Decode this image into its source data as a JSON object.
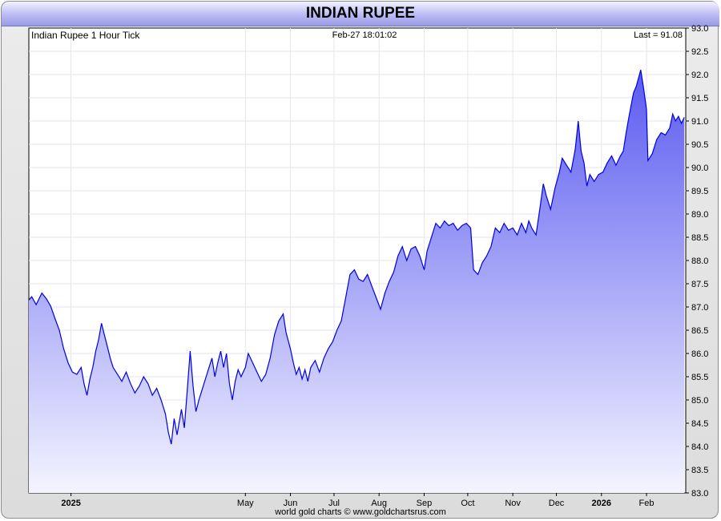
{
  "title": "INDIAN RUPEE",
  "footer": "world gold charts © www.goldchartsrus.com",
  "colors": {
    "line": "#0000e6",
    "fill_top": "#5b5bf0",
    "fill_bottom": "#f4f4ff",
    "grid": "#e6e6ee"
  },
  "chart_data": {
    "type": "area",
    "caption_left": "Indian Rupee 1 Hour Tick",
    "caption_center": "Feb-27  18:01:02",
    "caption_right": "Last = 91.08",
    "ylim": [
      83.0,
      93.0
    ],
    "xlim": [
      "2024-12-03",
      "2026-02-28"
    ],
    "grid": true,
    "y_ticks": [
      "93.0",
      "92.5",
      "92.0",
      "91.5",
      "91.0",
      "90.5",
      "90.0",
      "89.5",
      "89.0",
      "88.5",
      "88.0",
      "87.5",
      "87.0",
      "86.5",
      "86.0",
      "85.5",
      "85.0",
      "84.5",
      "84.0",
      "83.5",
      "83.0"
    ],
    "x_ticks": [
      {
        "label": "2025",
        "date": "2025-01-01",
        "bold": true
      },
      {
        "label": "May",
        "date": "2025-05-01",
        "bold": false
      },
      {
        "label": "Jun",
        "date": "2025-06-01",
        "bold": false
      },
      {
        "label": "Jul",
        "date": "2025-07-01",
        "bold": false
      },
      {
        "label": "Aug",
        "date": "2025-08-01",
        "bold": false
      },
      {
        "label": "Sep",
        "date": "2025-09-01",
        "bold": false
      },
      {
        "label": "Oct",
        "date": "2025-10-01",
        "bold": false
      },
      {
        "label": "Nov",
        "date": "2025-11-01",
        "bold": false
      },
      {
        "label": "Dec",
        "date": "2025-12-01",
        "bold": false
      },
      {
        "label": "2026",
        "date": "2026-01-01",
        "bold": true
      },
      {
        "label": "Feb",
        "date": "2026-02-01",
        "bold": false
      }
    ],
    "series": [
      {
        "points": [
          [
            "2024-12-03",
            87.15
          ],
          [
            "2024-12-05",
            87.22
          ],
          [
            "2024-12-08",
            87.05
          ],
          [
            "2024-12-12",
            87.3
          ],
          [
            "2024-12-15",
            87.18
          ],
          [
            "2024-12-18",
            87.02
          ],
          [
            "2024-12-21",
            86.75
          ],
          [
            "2024-12-24",
            86.5
          ],
          [
            "2024-12-27",
            86.1
          ],
          [
            "2024-12-30",
            85.8
          ],
          [
            "2025-01-02",
            85.6
          ],
          [
            "2025-01-05",
            85.55
          ],
          [
            "2025-01-08",
            85.7
          ],
          [
            "2025-01-10",
            85.35
          ],
          [
            "2025-01-12",
            85.1
          ],
          [
            "2025-01-14",
            85.45
          ],
          [
            "2025-01-16",
            85.7
          ],
          [
            "2025-01-18",
            86.05
          ],
          [
            "2025-01-20",
            86.3
          ],
          [
            "2025-01-22",
            86.65
          ],
          [
            "2025-01-24",
            86.4
          ],
          [
            "2025-01-26",
            86.15
          ],
          [
            "2025-01-28",
            85.9
          ],
          [
            "2025-01-30",
            85.7
          ],
          [
            "2025-02-02",
            85.55
          ],
          [
            "2025-02-05",
            85.4
          ],
          [
            "2025-02-08",
            85.6
          ],
          [
            "2025-02-11",
            85.35
          ],
          [
            "2025-02-14",
            85.15
          ],
          [
            "2025-02-17",
            85.3
          ],
          [
            "2025-02-20",
            85.5
          ],
          [
            "2025-02-23",
            85.35
          ],
          [
            "2025-02-26",
            85.1
          ],
          [
            "2025-03-01",
            85.25
          ],
          [
            "2025-03-04",
            85.0
          ],
          [
            "2025-03-07",
            84.7
          ],
          [
            "2025-03-09",
            84.3
          ],
          [
            "2025-03-11",
            84.05
          ],
          [
            "2025-03-13",
            84.6
          ],
          [
            "2025-03-15",
            84.25
          ],
          [
            "2025-03-18",
            84.8
          ],
          [
            "2025-03-20",
            84.4
          ],
          [
            "2025-03-22",
            85.2
          ],
          [
            "2025-03-24",
            86.05
          ],
          [
            "2025-03-26",
            85.3
          ],
          [
            "2025-03-28",
            84.75
          ],
          [
            "2025-03-30",
            85.0
          ],
          [
            "2025-04-02",
            85.3
          ],
          [
            "2025-04-05",
            85.6
          ],
          [
            "2025-04-08",
            85.9
          ],
          [
            "2025-04-10",
            85.5
          ],
          [
            "2025-04-12",
            85.8
          ],
          [
            "2025-04-14",
            86.05
          ],
          [
            "2025-04-16",
            85.7
          ],
          [
            "2025-04-18",
            86.0
          ],
          [
            "2025-04-20",
            85.35
          ],
          [
            "2025-04-22",
            85.0
          ],
          [
            "2025-04-24",
            85.4
          ],
          [
            "2025-04-26",
            85.65
          ],
          [
            "2025-04-28",
            85.5
          ],
          [
            "2025-05-01",
            85.7
          ],
          [
            "2025-05-03",
            86.0
          ],
          [
            "2025-05-06",
            85.8
          ],
          [
            "2025-05-09",
            85.6
          ],
          [
            "2025-05-12",
            85.4
          ],
          [
            "2025-05-15",
            85.55
          ],
          [
            "2025-05-18",
            85.9
          ],
          [
            "2025-05-21",
            86.4
          ],
          [
            "2025-05-24",
            86.7
          ],
          [
            "2025-05-27",
            86.85
          ],
          [
            "2025-05-29",
            86.45
          ],
          [
            "2025-06-01",
            86.1
          ],
          [
            "2025-06-03",
            85.8
          ],
          [
            "2025-06-05",
            85.55
          ],
          [
            "2025-06-07",
            85.7
          ],
          [
            "2025-06-09",
            85.45
          ],
          [
            "2025-06-11",
            85.65
          ],
          [
            "2025-06-13",
            85.4
          ],
          [
            "2025-06-15",
            85.7
          ],
          [
            "2025-06-18",
            85.85
          ],
          [
            "2025-06-21",
            85.6
          ],
          [
            "2025-06-24",
            85.9
          ],
          [
            "2025-06-27",
            86.1
          ],
          [
            "2025-06-30",
            86.25
          ],
          [
            "2025-07-03",
            86.5
          ],
          [
            "2025-07-06",
            86.7
          ],
          [
            "2025-07-09",
            87.2
          ],
          [
            "2025-07-12",
            87.7
          ],
          [
            "2025-07-15",
            87.8
          ],
          [
            "2025-07-18",
            87.6
          ],
          [
            "2025-07-21",
            87.55
          ],
          [
            "2025-07-24",
            87.7
          ],
          [
            "2025-07-27",
            87.45
          ],
          [
            "2025-07-30",
            87.2
          ],
          [
            "2025-08-02",
            86.95
          ],
          [
            "2025-08-05",
            87.3
          ],
          [
            "2025-08-08",
            87.55
          ],
          [
            "2025-08-11",
            87.75
          ],
          [
            "2025-08-14",
            88.1
          ],
          [
            "2025-08-17",
            88.3
          ],
          [
            "2025-08-20",
            88.0
          ],
          [
            "2025-08-23",
            88.25
          ],
          [
            "2025-08-26",
            88.3
          ],
          [
            "2025-08-29",
            88.1
          ],
          [
            "2025-09-01",
            87.8
          ],
          [
            "2025-09-03",
            88.2
          ],
          [
            "2025-09-06",
            88.5
          ],
          [
            "2025-09-09",
            88.8
          ],
          [
            "2025-09-12",
            88.7
          ],
          [
            "2025-09-15",
            88.85
          ],
          [
            "2025-09-18",
            88.75
          ],
          [
            "2025-09-21",
            88.8
          ],
          [
            "2025-09-24",
            88.65
          ],
          [
            "2025-09-27",
            88.75
          ],
          [
            "2025-09-30",
            88.8
          ],
          [
            "2025-10-03",
            88.7
          ],
          [
            "2025-10-05",
            87.8
          ],
          [
            "2025-10-08",
            87.7
          ],
          [
            "2025-10-11",
            87.95
          ],
          [
            "2025-10-14",
            88.1
          ],
          [
            "2025-10-17",
            88.3
          ],
          [
            "2025-10-20",
            88.7
          ],
          [
            "2025-10-23",
            88.6
          ],
          [
            "2025-10-26",
            88.8
          ],
          [
            "2025-10-29",
            88.65
          ],
          [
            "2025-11-01",
            88.7
          ],
          [
            "2025-11-04",
            88.55
          ],
          [
            "2025-11-07",
            88.8
          ],
          [
            "2025-11-10",
            88.6
          ],
          [
            "2025-11-12",
            88.85
          ],
          [
            "2025-11-14",
            88.7
          ],
          [
            "2025-11-17",
            88.55
          ],
          [
            "2025-11-20",
            89.2
          ],
          [
            "2025-11-22",
            89.65
          ],
          [
            "2025-11-24",
            89.4
          ],
          [
            "2025-11-27",
            89.1
          ],
          [
            "2025-11-30",
            89.55
          ],
          [
            "2025-12-03",
            89.9
          ],
          [
            "2025-12-05",
            90.2
          ],
          [
            "2025-12-08",
            90.05
          ],
          [
            "2025-12-11",
            89.9
          ],
          [
            "2025-12-14",
            90.4
          ],
          [
            "2025-12-16",
            91.0
          ],
          [
            "2025-12-18",
            90.35
          ],
          [
            "2025-12-20",
            90.1
          ],
          [
            "2025-12-22",
            89.6
          ],
          [
            "2025-12-24",
            89.85
          ],
          [
            "2025-12-27",
            89.7
          ],
          [
            "2025-12-30",
            89.85
          ],
          [
            "2026-01-02",
            89.9
          ],
          [
            "2026-01-05",
            90.1
          ],
          [
            "2026-01-08",
            90.25
          ],
          [
            "2026-01-11",
            90.05
          ],
          [
            "2026-01-14",
            90.25
          ],
          [
            "2026-01-16",
            90.35
          ],
          [
            "2026-01-18",
            90.75
          ],
          [
            "2026-01-20",
            91.1
          ],
          [
            "2026-01-23",
            91.6
          ],
          [
            "2026-01-25",
            91.75
          ],
          [
            "2026-01-28",
            92.1
          ],
          [
            "2026-01-30",
            91.7
          ],
          [
            "2026-02-01",
            91.25
          ],
          [
            "2026-02-02",
            90.15
          ],
          [
            "2026-02-05",
            90.3
          ],
          [
            "2026-02-08",
            90.6
          ],
          [
            "2026-02-11",
            90.75
          ],
          [
            "2026-02-14",
            90.7
          ],
          [
            "2026-02-17",
            90.85
          ],
          [
            "2026-02-19",
            91.15
          ],
          [
            "2026-02-21",
            91.0
          ],
          [
            "2026-02-23",
            91.1
          ],
          [
            "2026-02-25",
            90.95
          ],
          [
            "2026-02-27",
            91.08
          ]
        ]
      }
    ]
  }
}
